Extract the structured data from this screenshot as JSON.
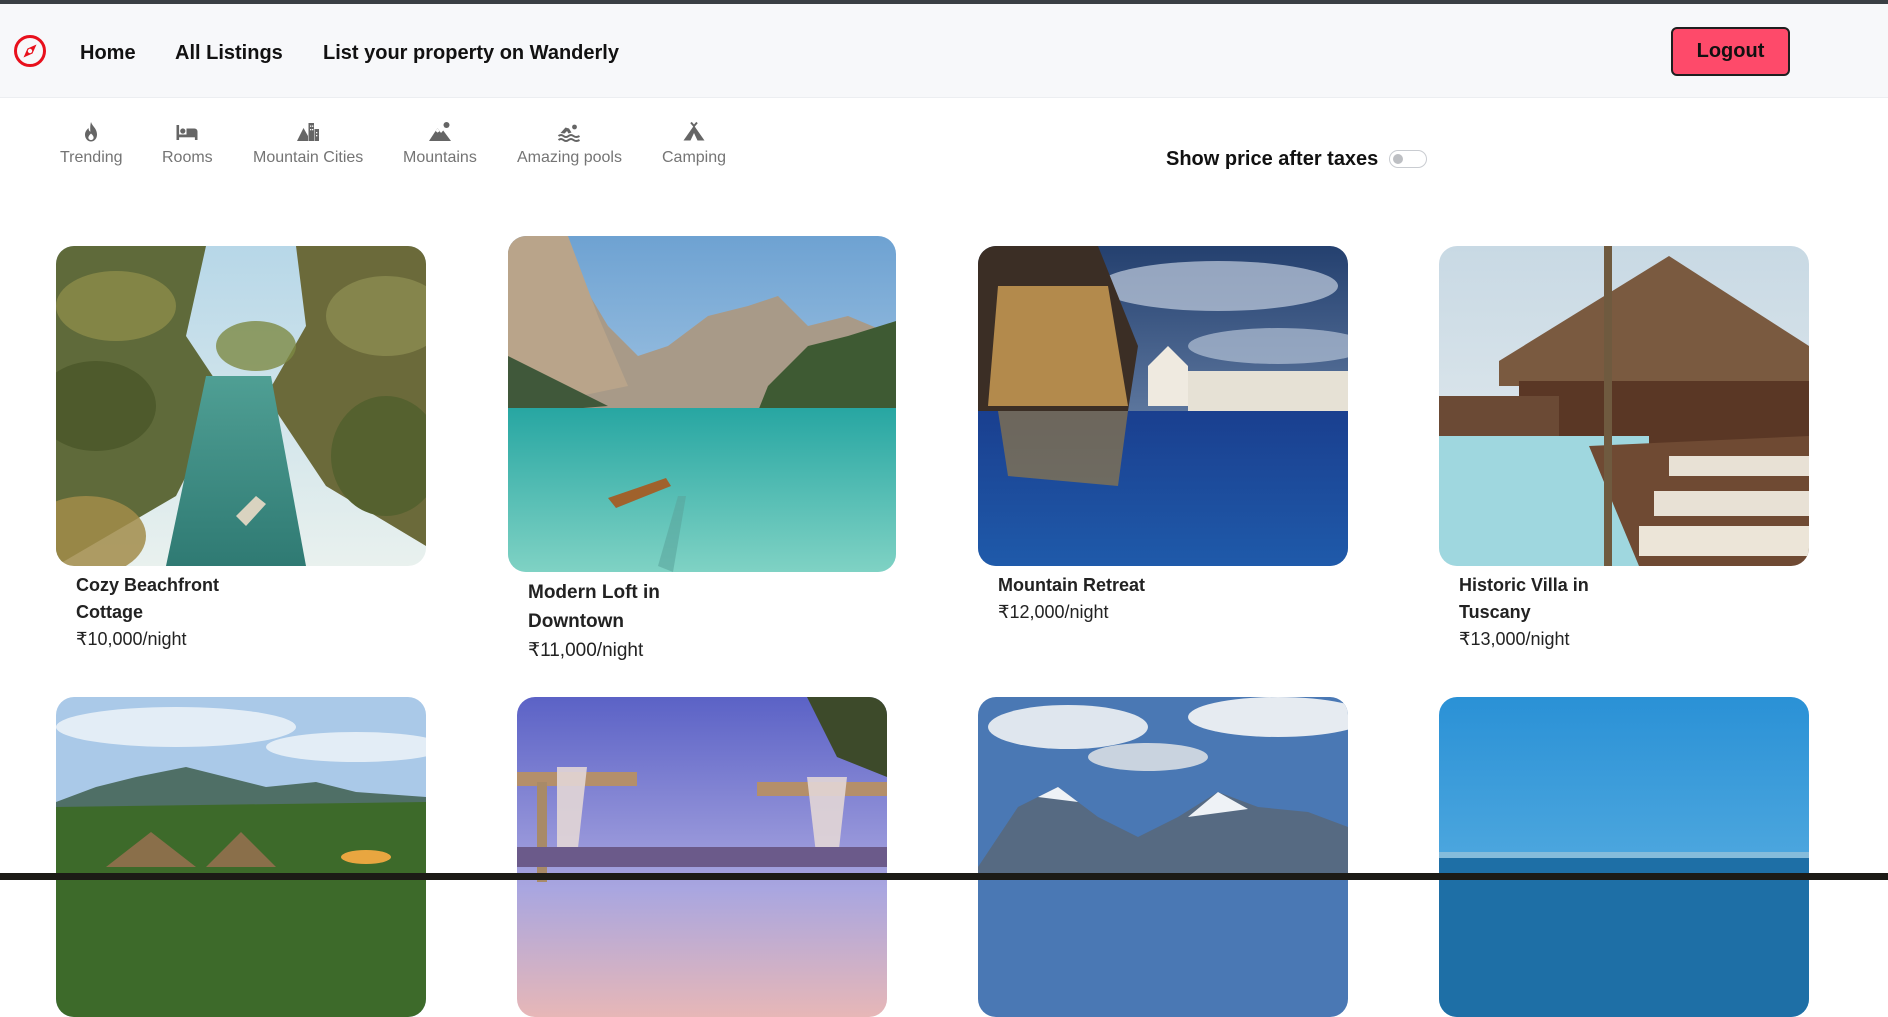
{
  "nav": {
    "logo_icon": "compass-icon",
    "links": [
      "Home",
      "All Listings",
      "List your property on Wanderly"
    ],
    "logout_label": "Logout"
  },
  "filters": [
    {
      "label": "Trending",
      "icon": "fire-icon"
    },
    {
      "label": "Rooms",
      "icon": "bed-icon"
    },
    {
      "label": "Mountain Cities",
      "icon": "mountain-city-icon"
    },
    {
      "label": "Mountains",
      "icon": "mountain-sun-icon"
    },
    {
      "label": "Amazing pools",
      "icon": "person-swimming-icon"
    },
    {
      "label": "Camping",
      "icon": "campground-icon"
    }
  ],
  "tax_toggle": {
    "label": "Show price after taxes",
    "checked": false
  },
  "listings": [
    {
      "title": "Cozy Beachfront Cottage",
      "price": "₹10,000/night"
    },
    {
      "title": "Modern Loft in Downtown",
      "price": "₹11,000/night"
    },
    {
      "title": "Mountain Retreat",
      "price": "₹12,000/night"
    },
    {
      "title": "Historic Villa in Tuscany",
      "price": "₹13,000/night"
    },
    {
      "title": "",
      "price": ""
    },
    {
      "title": "",
      "price": ""
    },
    {
      "title": "",
      "price": ""
    },
    {
      "title": "",
      "price": ""
    }
  ],
  "colors": {
    "accent": "#fe4a6a",
    "logo": "#e8101c",
    "navbar_bg": "#f7f8fa",
    "filter_text": "#666666"
  }
}
